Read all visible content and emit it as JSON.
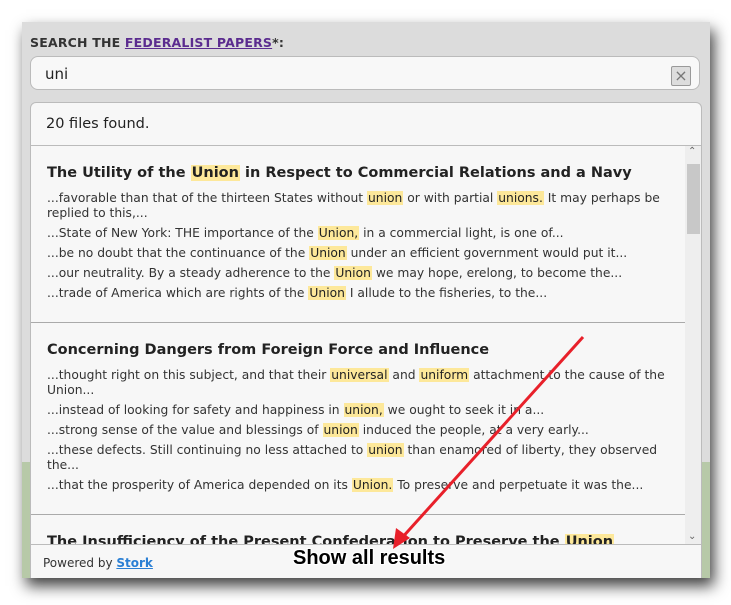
{
  "search": {
    "label_prefix": "SEARCH THE ",
    "label_link": "FEDERALIST PAPERS",
    "label_suffix": "*:",
    "value": "uni",
    "clear_icon": "close-icon"
  },
  "results": {
    "count_text": "20 files found.",
    "items": [
      {
        "title": [
          {
            "t": "The Utility of the "
          },
          {
            "t": "Union",
            "h": true
          },
          {
            "t": " in Respect to Commercial Relations and a Navy"
          }
        ],
        "excerpts": [
          [
            {
              "t": "...favorable than that of the thirteen States without "
            },
            {
              "t": "union",
              "h": true
            },
            {
              "t": " or with partial "
            },
            {
              "t": "unions.",
              "h": true
            },
            {
              "t": " It may perhaps be replied to this,..."
            }
          ],
          [
            {
              "t": "...State of New York: THE importance of the "
            },
            {
              "t": "Union,",
              "h": true
            },
            {
              "t": " in a commercial light, is one of..."
            }
          ],
          [
            {
              "t": "...be no doubt that the continuance of the "
            },
            {
              "t": "Union",
              "h": true
            },
            {
              "t": " under an efficient government would put it..."
            }
          ],
          [
            {
              "t": "...our neutrality. By a steady adherence to the "
            },
            {
              "t": "Union",
              "h": true
            },
            {
              "t": " we may hope, erelong, to become the..."
            }
          ],
          [
            {
              "t": "...trade of America which are rights of the "
            },
            {
              "t": "Union",
              "h": true
            },
            {
              "t": " I allude to the fisheries, to the..."
            }
          ]
        ]
      },
      {
        "title": [
          {
            "t": "Concerning Dangers from Foreign Force and Influence"
          }
        ],
        "excerpts": [
          [
            {
              "t": "...thought right on this subject, and that their "
            },
            {
              "t": "universal",
              "h": true
            },
            {
              "t": " and "
            },
            {
              "t": "uniform",
              "h": true
            },
            {
              "t": " attachment to the cause of the Union..."
            }
          ],
          [
            {
              "t": "...instead of looking for safety and happiness in "
            },
            {
              "t": "union,",
              "h": true
            },
            {
              "t": " we ought to seek it in a..."
            }
          ],
          [
            {
              "t": "...strong sense of the value and blessings of "
            },
            {
              "t": "union",
              "h": true
            },
            {
              "t": " induced the people, at a very early..."
            }
          ],
          [
            {
              "t": "...these defects. Still continuing no less attached to "
            },
            {
              "t": "union",
              "h": true
            },
            {
              "t": " than enamored of liberty, they observed the..."
            }
          ],
          [
            {
              "t": "...that the prosperity of America depended on its "
            },
            {
              "t": "Union.",
              "h": true
            },
            {
              "t": " To preserve and perpetuate it was the..."
            }
          ]
        ]
      },
      {
        "title": [
          {
            "t": "The Insufficiency of the Present Confederation to Preserve the "
          },
          {
            "t": "Union",
            "h": true
          }
        ],
        "excerpts": []
      }
    ]
  },
  "footer": {
    "powered_prefix": "Powered by ",
    "powered_link": "Stork"
  },
  "annotation": {
    "text": "Show all results",
    "arrow_color": "#e8202a"
  },
  "colors": {
    "highlight": "#fde89a",
    "link": "#5b2c8f",
    "stork_link": "#2a7fd4"
  }
}
